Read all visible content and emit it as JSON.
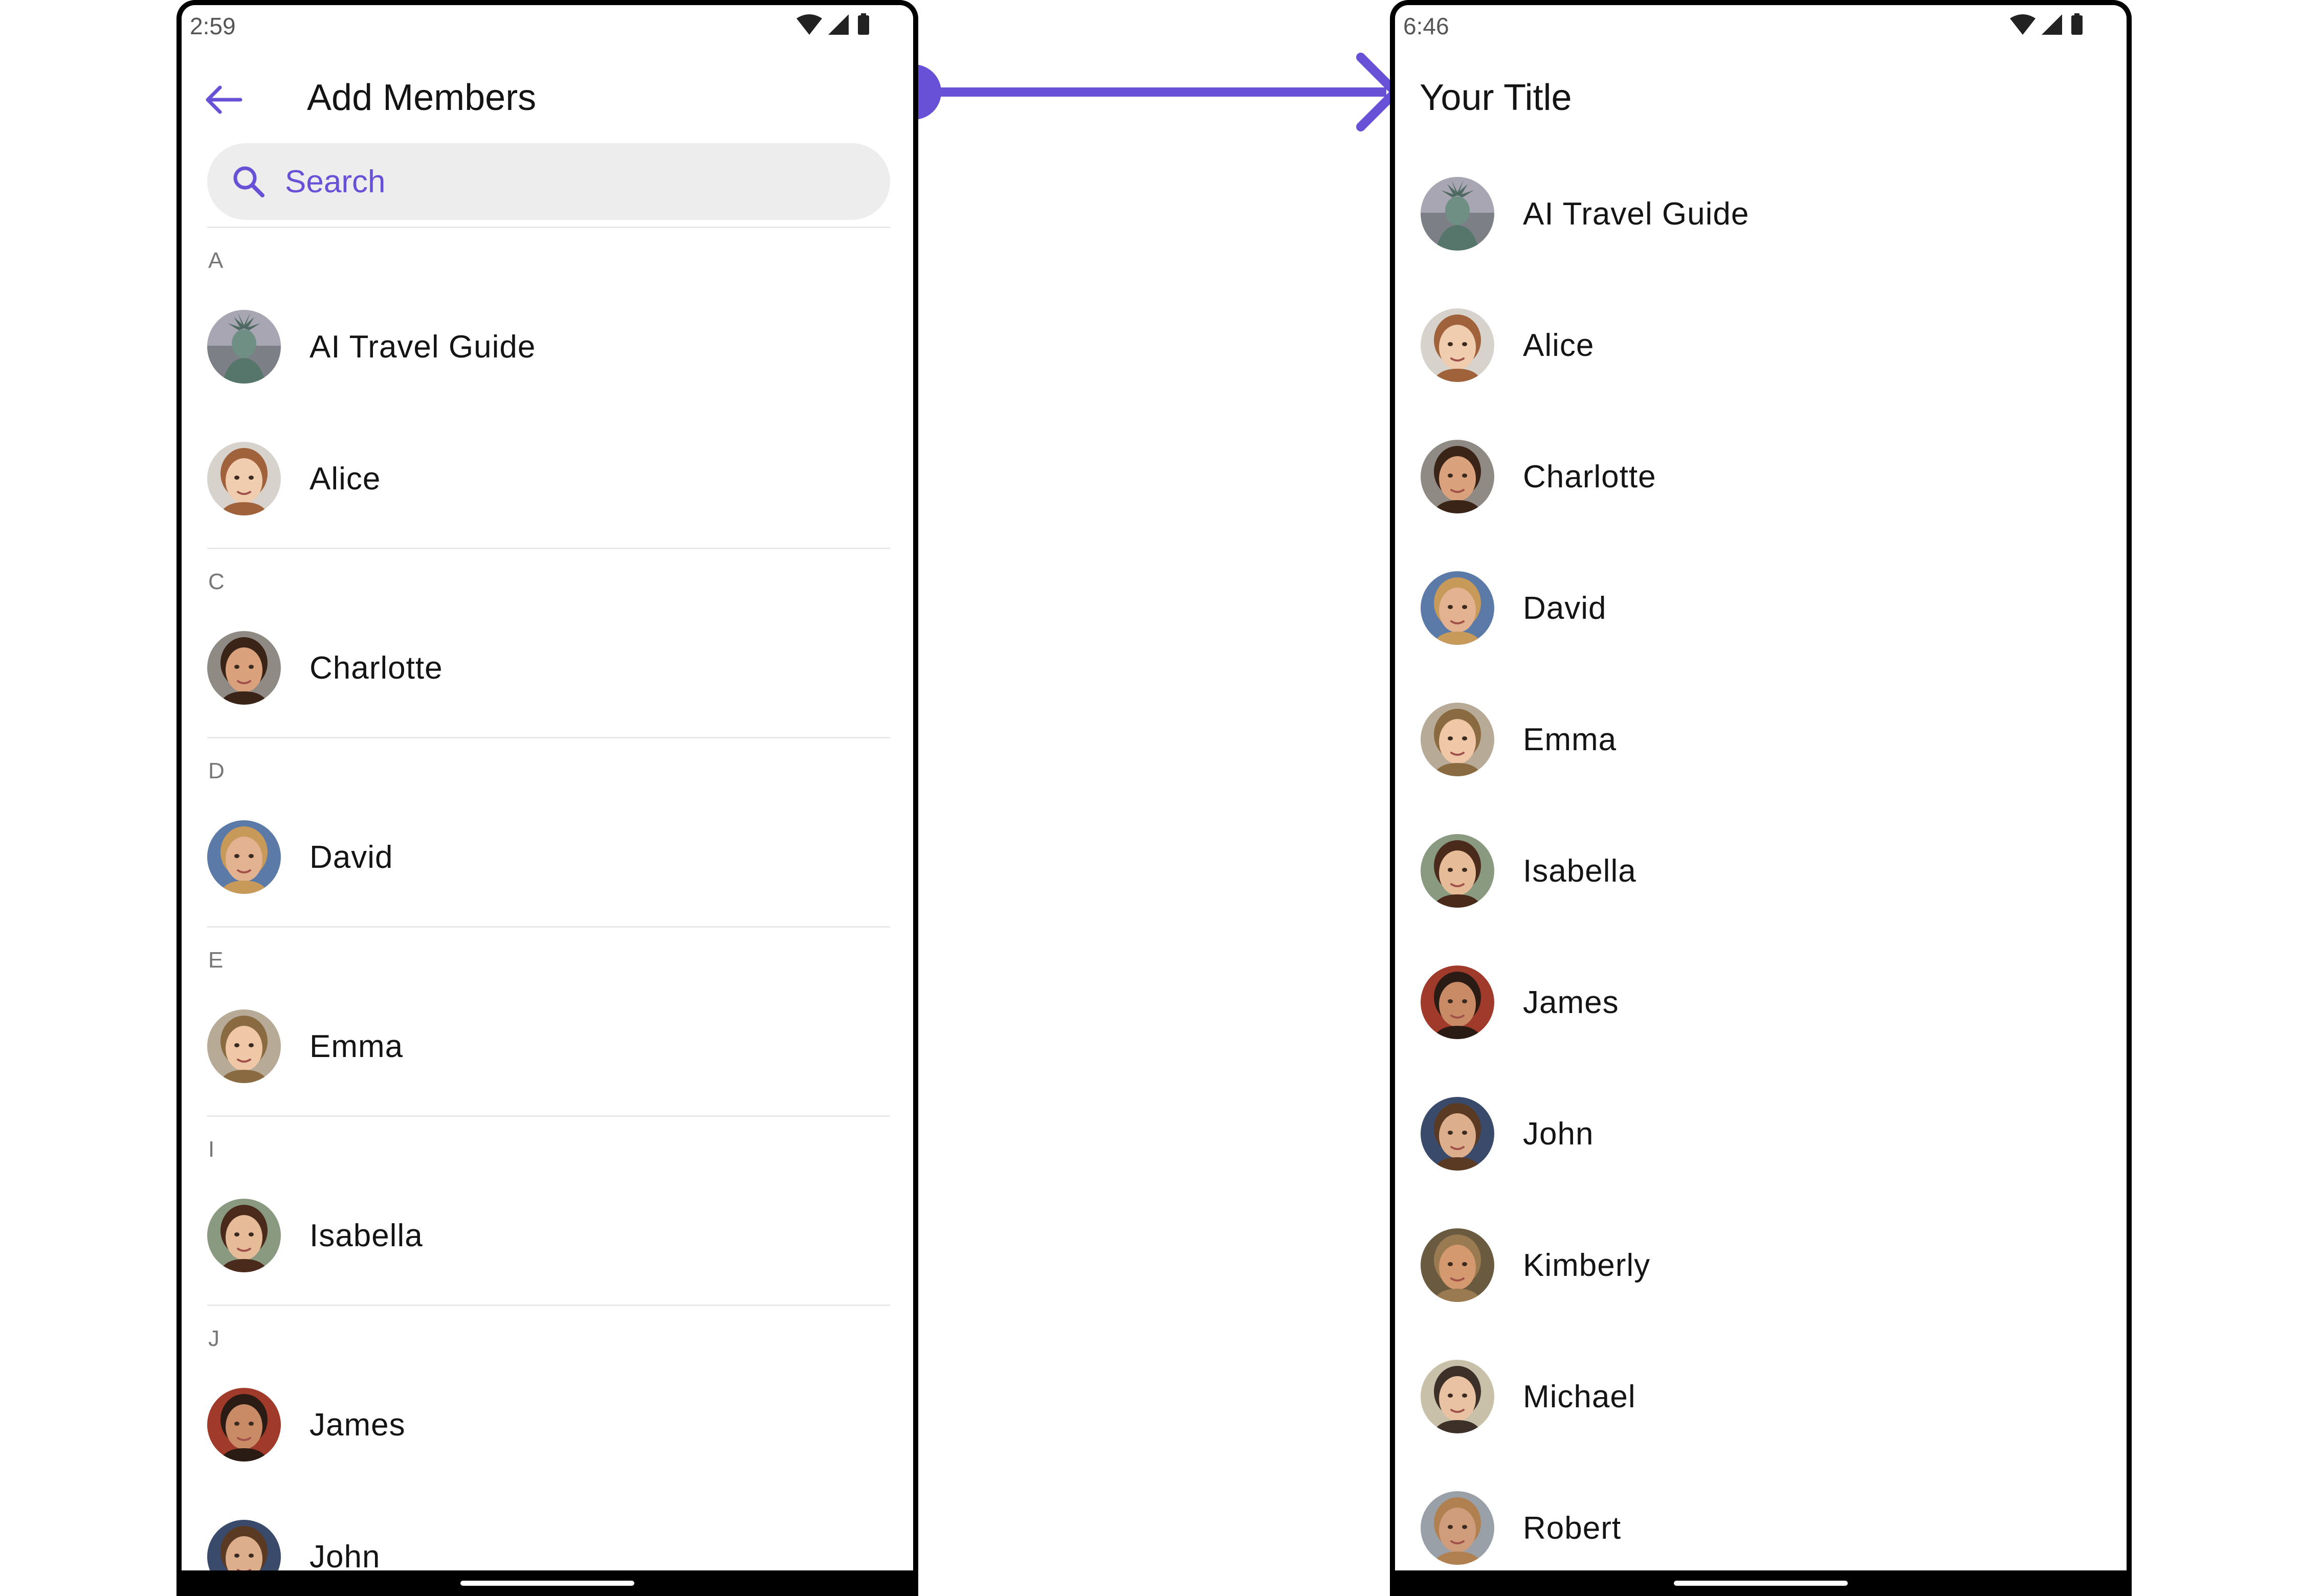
{
  "colors": {
    "accent": "#6851d6"
  },
  "left_screen": {
    "status_time": "2:59",
    "status_icons": [
      "wifi-icon",
      "cell-signal-icon",
      "battery-icon"
    ],
    "title": "Add Members",
    "back_icon": "arrow-left-icon",
    "search": {
      "placeholder": "Search",
      "icon": "search-icon"
    },
    "sections": [
      {
        "letter": "A",
        "members": [
          {
            "name": "AI Travel Guide",
            "avatar": "statue"
          },
          {
            "name": "Alice",
            "avatar": "face"
          }
        ]
      },
      {
        "letter": "C",
        "members": [
          {
            "name": "Charlotte",
            "avatar": "face"
          }
        ]
      },
      {
        "letter": "D",
        "members": [
          {
            "name": "David",
            "avatar": "face"
          }
        ]
      },
      {
        "letter": "E",
        "members": [
          {
            "name": "Emma",
            "avatar": "face"
          }
        ]
      },
      {
        "letter": "I",
        "members": [
          {
            "name": "Isabella",
            "avatar": "face"
          }
        ]
      },
      {
        "letter": "J",
        "members": [
          {
            "name": "James",
            "avatar": "face"
          },
          {
            "name": "John",
            "avatar": "face"
          }
        ]
      }
    ]
  },
  "right_screen": {
    "status_time": "6:46",
    "status_icons": [
      "wifi-icon",
      "cell-signal-icon",
      "battery-icon"
    ],
    "title": "Your Title",
    "members": [
      {
        "name": "AI Travel Guide",
        "avatar": "statue"
      },
      {
        "name": "Alice",
        "avatar": "face"
      },
      {
        "name": "Charlotte",
        "avatar": "face"
      },
      {
        "name": "David",
        "avatar": "face"
      },
      {
        "name": "Emma",
        "avatar": "face"
      },
      {
        "name": "Isabella",
        "avatar": "face"
      },
      {
        "name": "James",
        "avatar": "face"
      },
      {
        "name": "John",
        "avatar": "face"
      },
      {
        "name": "Kimberly",
        "avatar": "face"
      },
      {
        "name": "Michael",
        "avatar": "face"
      },
      {
        "name": "Robert",
        "avatar": "face"
      }
    ]
  }
}
